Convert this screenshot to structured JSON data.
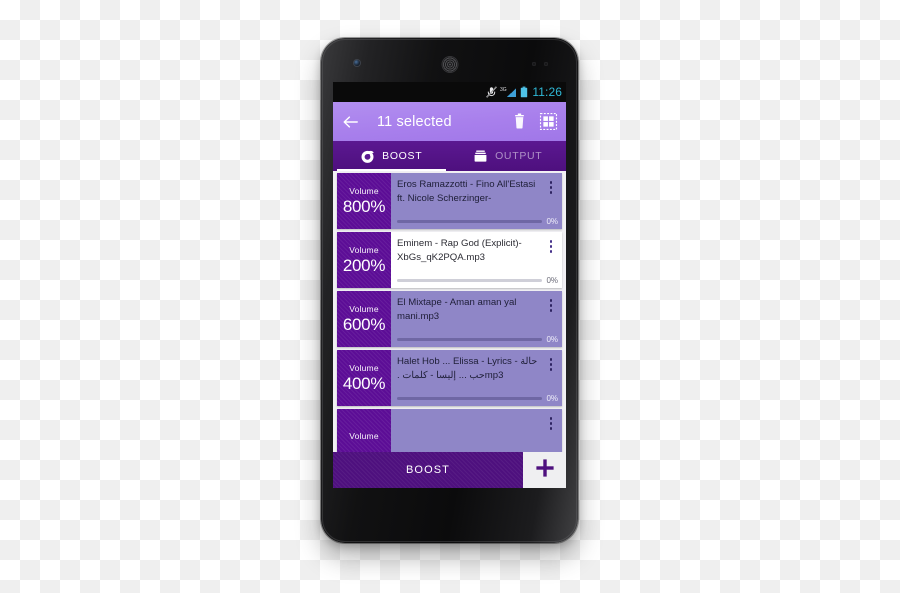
{
  "status_bar": {
    "time": "11:26",
    "icons": [
      "vibrate-mute-icon",
      "signal-3g-icon",
      "battery-icon"
    ],
    "network_label": "3G",
    "clock_color": "#2FB8D6"
  },
  "action_bar": {
    "back_icon": "back-arrow-icon",
    "title": "11 selected",
    "delete_icon": "trash-icon",
    "select_grid_icon": "select-all-grid-icon",
    "background_color": "#A87FEC"
  },
  "tabs": [
    {
      "label": "BOOST",
      "icon": "boost-speaker-icon",
      "active": true
    },
    {
      "label": "OUTPUT",
      "icon": "output-folder-icon",
      "active": false
    }
  ],
  "list": {
    "volume_label": "Volume",
    "items": [
      {
        "volume": "800%",
        "title": "Eros Ramazzotti - Fino All'Estasi ft. Nicole Scherzinger-",
        "title_rtl": "",
        "progress": "0%",
        "progress_value": 0,
        "selected": true
      },
      {
        "volume": "200%",
        "title": "Eminem - Rap God (Explicit)-XbGs_qK2PQA.mp3",
        "title_rtl": "",
        "progress": "0%",
        "progress_value": 0,
        "selected": false
      },
      {
        "volume": "600%",
        "title": "El Mixtape - Aman aman yal mani.mp3",
        "title_rtl": "",
        "progress": "0%",
        "progress_value": 0,
        "selected": true
      },
      {
        "volume": "400%",
        "title": "Halet Hob ... Elissa - Lyrics - ",
        "title_rtl": "حالة حب ... إليسا - كلمات .",
        "title_suffix": "mp3",
        "progress": "0%",
        "progress_value": 0,
        "selected": true
      },
      {
        "volume": "",
        "title": "",
        "title_rtl": "",
        "progress": "",
        "progress_value": 0,
        "selected": true
      }
    ]
  },
  "bottom_bar": {
    "boost_label": "BOOST",
    "add_icon": "plus-icon",
    "boost_color": "#4E107E",
    "plus_color": "#4E107E"
  },
  "theme": {
    "accent_purple": "#5C0D96",
    "light_purple": "#A87FEC",
    "selected_card": "#8F86C7",
    "tab_bar": "#4E107E"
  }
}
